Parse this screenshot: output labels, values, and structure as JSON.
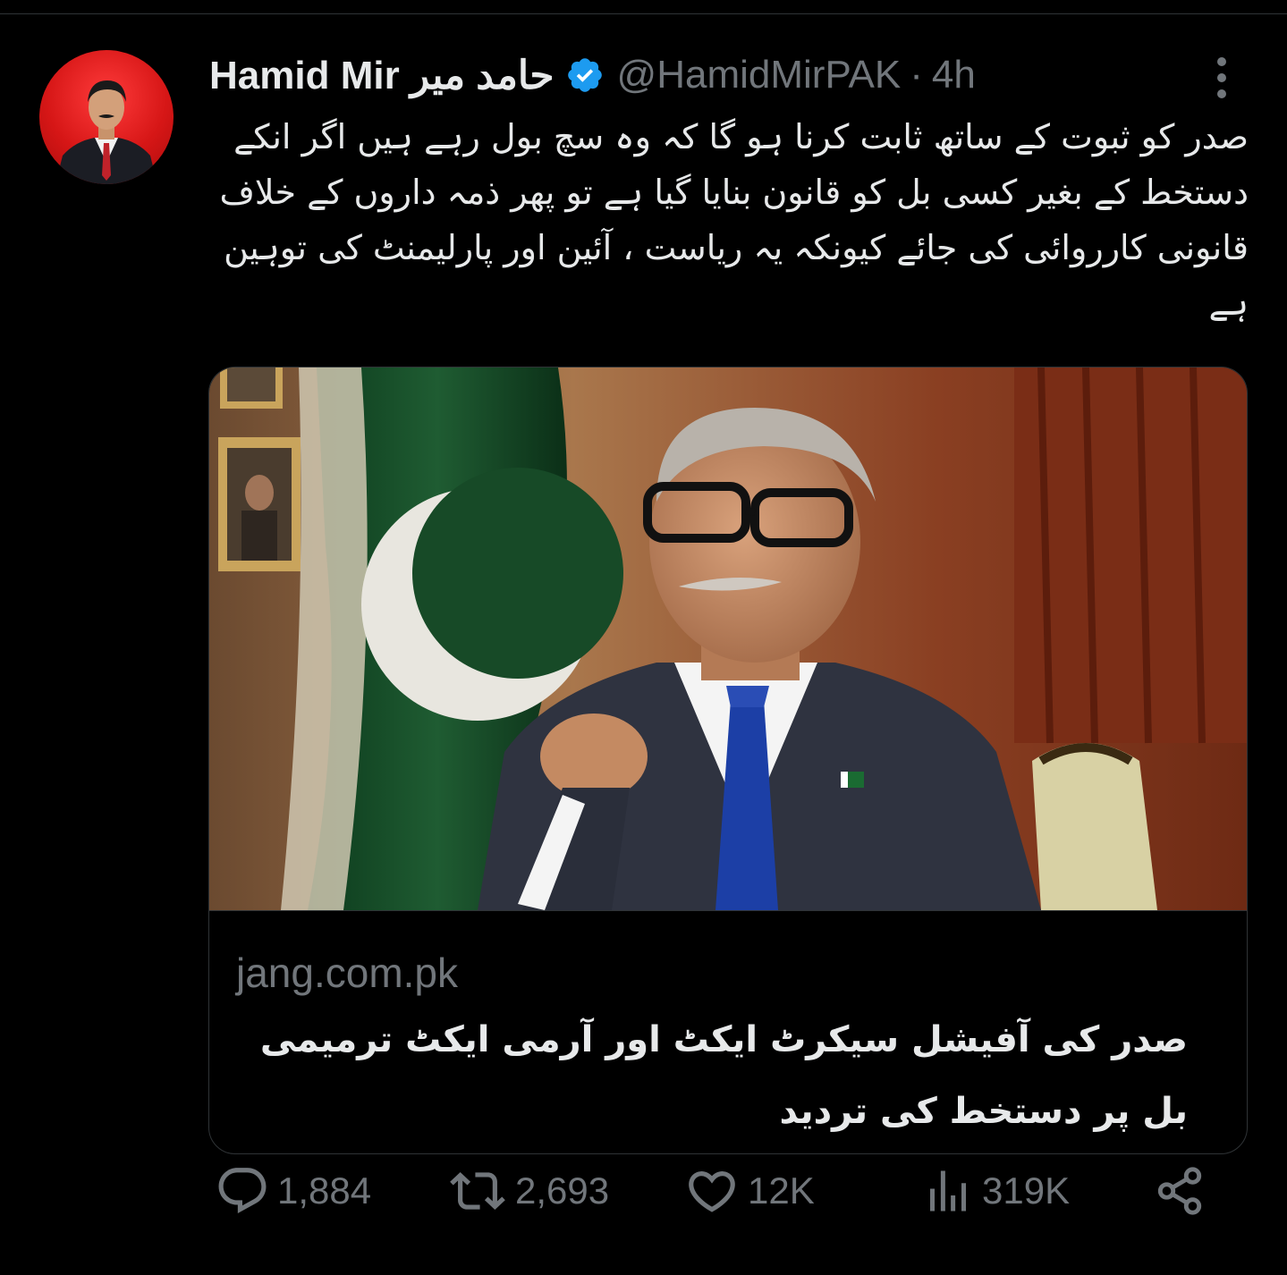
{
  "tweet": {
    "author": {
      "display_name": "Hamid Mir حامد میر",
      "handle": "@HamidMirPAK",
      "verified": true,
      "avatar_icon": "avatar-photo"
    },
    "separator": "·",
    "timestamp": "4h",
    "more_icon": "more-vertical-icon",
    "text": "صدر کو ثبوت کے ساتھ ثابت کرنا ہو گا کہ وہ سچ بول رہے ہیں اگر انکے دستخط کے بغیر کسی بل کو قانون بنایا گیا ہے تو پھر ذمہ داروں کے خلاف قانونی کارروائی کی جائے کیونکہ یہ ریاست ، آئین اور پارلیمنٹ کی توہین ہے",
    "link_card": {
      "domain": "jang.com.pk",
      "title": "صدر کی آفیشل سیکرٹ ایکٹ اور آرمی ایکٹ ترمیمی بل پر دستخط کی تردید"
    },
    "actions": {
      "replies": "1,884",
      "retweets": "2,693",
      "likes": "12K",
      "views": "319K"
    }
  },
  "colors": {
    "background": "#000000",
    "primary_text": "#e7e9ea",
    "secondary_text": "#71767b",
    "verified_badge": "#1d9bf0",
    "border": "#2f3336"
  }
}
